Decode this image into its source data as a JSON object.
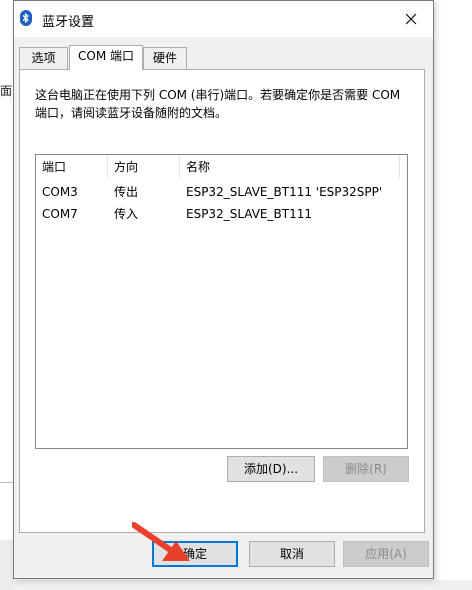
{
  "background": {
    "left_text": "面"
  },
  "window": {
    "title": "蓝牙设置",
    "icon": "bluetooth-icon",
    "close_glyph": "✕"
  },
  "tabs": [
    {
      "label": "选项",
      "active": false
    },
    {
      "label": "COM 端口",
      "active": true
    },
    {
      "label": "硬件",
      "active": false
    }
  ],
  "panel": {
    "description": "这台电脑正在使用下列 COM (串行)端口。若要确定你是否需要 COM 端口，请阅读蓝牙设备随附的文档。",
    "columns": [
      "端口",
      "方向",
      "名称"
    ],
    "rows": [
      {
        "port": "COM3",
        "direction": "传出",
        "name": "ESP32_SLAVE_BT111 'ESP32SPP'"
      },
      {
        "port": "COM7",
        "direction": "传入",
        "name": "ESP32_SLAVE_BT111"
      }
    ],
    "add_button": "添加(D)...",
    "remove_button": "删除(R)"
  },
  "footer": {
    "ok_button": "确定",
    "cancel_button": "取消",
    "apply_button": "应用(A)"
  },
  "colors": {
    "focus_border": "#0078d7",
    "annotation_arrow": "#e8402a",
    "bluetooth_icon": "#1f5fbf"
  }
}
